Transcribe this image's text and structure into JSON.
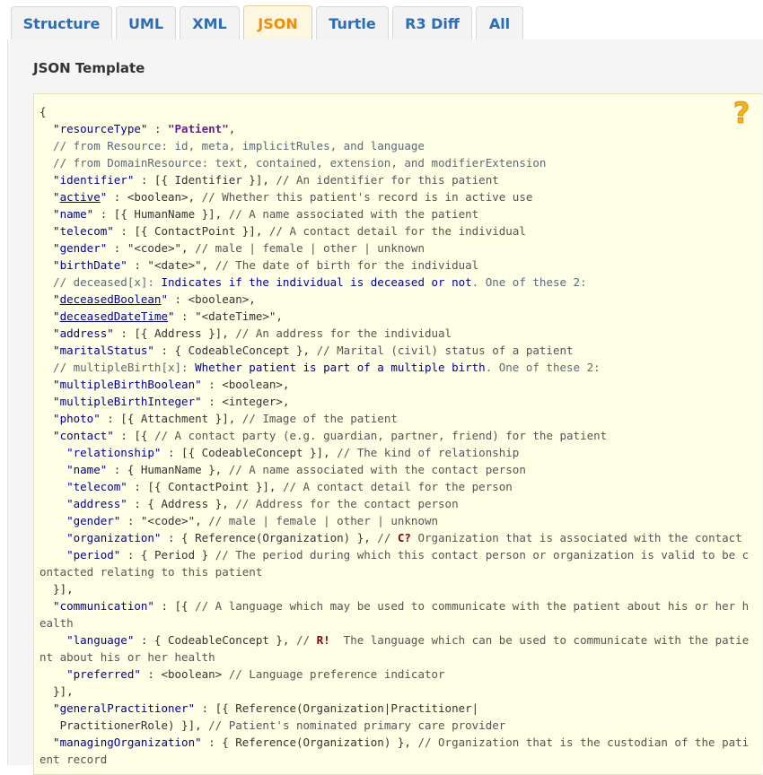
{
  "tabs": [
    {
      "label": "Structure",
      "active": false
    },
    {
      "label": "UML",
      "active": false
    },
    {
      "label": "XML",
      "active": false
    },
    {
      "label": "JSON",
      "active": true
    },
    {
      "label": "Turtle",
      "active": false
    },
    {
      "label": "R3 Diff",
      "active": false
    },
    {
      "label": "All",
      "active": false
    }
  ],
  "panel": {
    "title": "JSON Template"
  },
  "help_icon": "question-mark-icon",
  "colors": {
    "accent": "#f28c00",
    "link": "#2a6ebb",
    "code_bg": "#ffffe6",
    "help": "#f6b21b"
  },
  "code_lines": [
    {
      "segs": [
        {
          "t": "{",
          "c": "ty"
        }
      ]
    },
    {
      "segs": [
        {
          "t": "  \"resourceType\"",
          "c": "s"
        },
        {
          "t": " : ",
          "c": "ty"
        },
        {
          "t": "\"Patient\"",
          "c": "v"
        },
        {
          "t": ",",
          "c": "ty"
        }
      ]
    },
    {
      "segs": [
        {
          "t": "  // from Resource: id, meta, implicitRules, and language",
          "c": "i"
        }
      ]
    },
    {
      "segs": [
        {
          "t": "  // from DomainResource: text, contained, extension, and modifierExtension",
          "c": "i"
        }
      ]
    },
    {
      "segs": [
        {
          "t": "  \"identifier\"",
          "c": "s"
        },
        {
          "t": " : [{ Identifier }], ",
          "c": "ty"
        },
        {
          "t": "// An identifier for this patient",
          "c": "c"
        }
      ]
    },
    {
      "segs": [
        {
          "t": "  \"",
          "c": "s"
        },
        {
          "t": "active",
          "c": "u"
        },
        {
          "t": "\"",
          "c": "s"
        },
        {
          "t": " : <boolean>, ",
          "c": "ty"
        },
        {
          "t": "// Whether this patient's record is in active use",
          "c": "c"
        }
      ]
    },
    {
      "segs": [
        {
          "t": "  \"name\"",
          "c": "s"
        },
        {
          "t": " : [{ HumanName }], ",
          "c": "ty"
        },
        {
          "t": "// A name associated with the patient",
          "c": "c"
        }
      ]
    },
    {
      "segs": [
        {
          "t": "  \"telecom\"",
          "c": "s"
        },
        {
          "t": " : [{ ContactPoint }], ",
          "c": "ty"
        },
        {
          "t": "// A contact detail for the individual",
          "c": "c"
        }
      ]
    },
    {
      "segs": [
        {
          "t": "  \"gender\"",
          "c": "s"
        },
        {
          "t": " : \"<code>\", ",
          "c": "ty"
        },
        {
          "t": "// male | female | other | unknown",
          "c": "c"
        }
      ]
    },
    {
      "segs": [
        {
          "t": "  \"birthDate\"",
          "c": "s"
        },
        {
          "t": " : \"<date>\", ",
          "c": "ty"
        },
        {
          "t": "// The date of birth for the individual",
          "c": "c"
        }
      ]
    },
    {
      "segs": [
        {
          "t": "  // deceased[x]: ",
          "c": "i"
        },
        {
          "t": "Indicates if the individual is deceased or not",
          "c": "s"
        },
        {
          "t": ". One of these 2:",
          "c": "i"
        }
      ]
    },
    {
      "segs": [
        {
          "t": "  \"",
          "c": "s"
        },
        {
          "t": "deceasedBoolean",
          "c": "u"
        },
        {
          "t": "\"",
          "c": "s"
        },
        {
          "t": " : <boolean>,",
          "c": "ty"
        }
      ]
    },
    {
      "segs": [
        {
          "t": "  \"",
          "c": "s"
        },
        {
          "t": "deceasedDateTime",
          "c": "u"
        },
        {
          "t": "\"",
          "c": "s"
        },
        {
          "t": " : \"<dateTime>\",",
          "c": "ty"
        }
      ]
    },
    {
      "segs": [
        {
          "t": "  \"address\"",
          "c": "s"
        },
        {
          "t": " : [{ Address }], ",
          "c": "ty"
        },
        {
          "t": "// An address for the individual",
          "c": "c"
        }
      ]
    },
    {
      "segs": [
        {
          "t": "  \"maritalStatus\"",
          "c": "s"
        },
        {
          "t": " : { CodeableConcept }, ",
          "c": "ty"
        },
        {
          "t": "// Marital (civil) status of a patient",
          "c": "c"
        }
      ]
    },
    {
      "segs": [
        {
          "t": "  // multipleBirth[x]: ",
          "c": "i"
        },
        {
          "t": "Whether patient is part of a multiple birth",
          "c": "s"
        },
        {
          "t": ". One of these 2:",
          "c": "i"
        }
      ]
    },
    {
      "segs": [
        {
          "t": "  \"multipleBirthBoolean\"",
          "c": "s"
        },
        {
          "t": " : <boolean>,",
          "c": "ty"
        }
      ]
    },
    {
      "segs": [
        {
          "t": "  \"multipleBirthInteger\"",
          "c": "s"
        },
        {
          "t": " : <integer>,",
          "c": "ty"
        }
      ]
    },
    {
      "segs": [
        {
          "t": "  \"photo\"",
          "c": "s"
        },
        {
          "t": " : [{ Attachment }], ",
          "c": "ty"
        },
        {
          "t": "// Image of the patient",
          "c": "c"
        }
      ]
    },
    {
      "segs": [
        {
          "t": "  \"contact\"",
          "c": "s"
        },
        {
          "t": " : [{ ",
          "c": "ty"
        },
        {
          "t": "// A contact party (e.g. guardian, partner, friend) for the patient",
          "c": "c"
        }
      ]
    },
    {
      "segs": [
        {
          "t": "    \"relationship\"",
          "c": "s"
        },
        {
          "t": " : [{ CodeableConcept }], ",
          "c": "ty"
        },
        {
          "t": "// The kind of relationship",
          "c": "c"
        }
      ]
    },
    {
      "segs": [
        {
          "t": "    \"name\"",
          "c": "s"
        },
        {
          "t": " : { HumanName }, ",
          "c": "ty"
        },
        {
          "t": "// A name associated with the contact person",
          "c": "c"
        }
      ]
    },
    {
      "segs": [
        {
          "t": "    \"telecom\"",
          "c": "s"
        },
        {
          "t": " : [{ ContactPoint }], ",
          "c": "ty"
        },
        {
          "t": "// A contact detail for the person",
          "c": "c"
        }
      ]
    },
    {
      "segs": [
        {
          "t": "    \"address\"",
          "c": "s"
        },
        {
          "t": " : { Address }, ",
          "c": "ty"
        },
        {
          "t": "// Address for the contact person",
          "c": "c"
        }
      ]
    },
    {
      "segs": [
        {
          "t": "    \"gender\"",
          "c": "s"
        },
        {
          "t": " : \"<code>\", ",
          "c": "ty"
        },
        {
          "t": "// male | female | other | unknown",
          "c": "c"
        }
      ]
    },
    {
      "segs": [
        {
          "t": "    \"organization\"",
          "c": "s"
        },
        {
          "t": " : { Reference(Organization) }, ",
          "c": "ty"
        },
        {
          "t": "// ",
          "c": "c"
        },
        {
          "t": "C?",
          "c": "flag"
        },
        {
          "t": " Organization that is associated with the contact",
          "c": "c"
        }
      ]
    },
    {
      "segs": [
        {
          "t": "    \"period\"",
          "c": "s"
        },
        {
          "t": " : { Period } ",
          "c": "ty"
        },
        {
          "t": "// The period during which this contact person or organization is valid to be c",
          "c": "c"
        }
      ]
    },
    {
      "segs": [
        {
          "t": "ontacted relating to this patient",
          "c": "c"
        }
      ]
    },
    {
      "segs": [
        {
          "t": "  }],",
          "c": "ty"
        }
      ]
    },
    {
      "segs": [
        {
          "t": "  \"communication\"",
          "c": "s"
        },
        {
          "t": " : [{ ",
          "c": "ty"
        },
        {
          "t": "// A language which may be used to communicate with the patient about his or her h",
          "c": "c"
        }
      ]
    },
    {
      "segs": [
        {
          "t": "ealth",
          "c": "c"
        }
      ]
    },
    {
      "segs": [
        {
          "t": "    \"language\"",
          "c": "s"
        },
        {
          "t": " : { CodeableConcept }, ",
          "c": "ty"
        },
        {
          "t": "// ",
          "c": "c"
        },
        {
          "t": "R!",
          "c": "flag"
        },
        {
          "t": "  The language which can be used to communicate with the patie",
          "c": "c"
        }
      ]
    },
    {
      "segs": [
        {
          "t": "nt about his or her health",
          "c": "c"
        }
      ]
    },
    {
      "segs": [
        {
          "t": "    \"preferred\"",
          "c": "s"
        },
        {
          "t": " : <boolean> ",
          "c": "ty"
        },
        {
          "t": "// Language preference indicator",
          "c": "c"
        }
      ]
    },
    {
      "segs": [
        {
          "t": "  }],",
          "c": "ty"
        }
      ]
    },
    {
      "segs": [
        {
          "t": "  \"generalPractitioner\"",
          "c": "s"
        },
        {
          "t": " : [{ Reference(Organization|Practitioner|",
          "c": "ty"
        }
      ]
    },
    {
      "segs": [
        {
          "t": "   PractitionerRole) }], ",
          "c": "ty"
        },
        {
          "t": "// Patient's nominated primary care provider",
          "c": "c"
        }
      ]
    },
    {
      "segs": [
        {
          "t": "  \"managingOrganization\"",
          "c": "s"
        },
        {
          "t": " : { Reference(Organization) }, ",
          "c": "ty"
        },
        {
          "t": "// Organization that is the custodian of the pati",
          "c": "c"
        }
      ]
    },
    {
      "segs": [
        {
          "t": "ent record",
          "c": "c"
        }
      ]
    }
  ]
}
